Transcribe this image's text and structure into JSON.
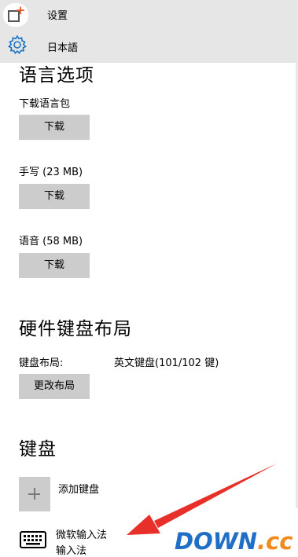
{
  "titlebar": {
    "title": "设置",
    "language": "日本語",
    "app_icon": "app-settings-icon",
    "lang_icon": "gear-icon"
  },
  "language_options": {
    "heading": "语言选项",
    "download_pack_label": "下载语言包",
    "download_pack_button": "下载",
    "handwriting_label": "手写 (23 MB)",
    "handwriting_button": "下载",
    "speech_label": "语音 (58 MB)",
    "speech_button": "下载"
  },
  "hardware_keyboard": {
    "heading": "硬件键盘布局",
    "layout_label": "键盘布局:",
    "layout_value": "英文键盘(101/102 键)",
    "change_button": "更改布局"
  },
  "keyboards": {
    "heading": "键盘",
    "add_label": "添加键盘",
    "items": [
      {
        "name": "微软输入法",
        "subtitle": "输入法",
        "icon": "keyboard-icon"
      }
    ]
  },
  "watermark": {
    "text": "DOWN.cc"
  },
  "colors": {
    "titlebar_bg": "#e6e6e6",
    "button_bg": "#cccccc",
    "arrow": "#e8302a",
    "watermark_blue": "#1f6fc6",
    "watermark_orange": "#f08a1c"
  }
}
